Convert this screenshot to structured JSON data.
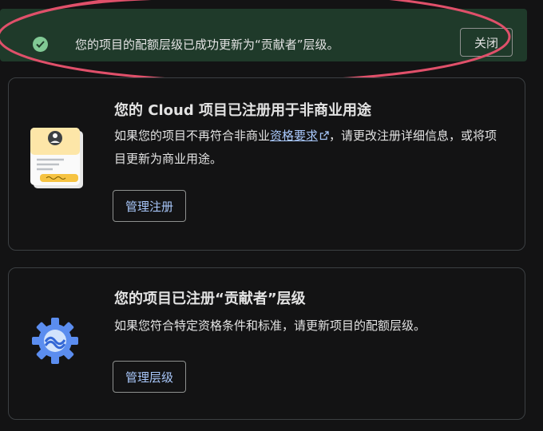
{
  "banner": {
    "message": "您的项目的配额层级已成功更新为“贡献者”层级。",
    "close_label": "关闭"
  },
  "cards": [
    {
      "title": "您的 Cloud 项目已注册用于非商业用途",
      "body_prefix": "如果您的项目不再符合非商业",
      "body_link": "资格要求",
      "body_suffix": "，请更改注册详细信息，或将项目更新为商业用途。",
      "button_label": "管理注册"
    },
    {
      "title": "您的项目已注册“贡献者”层级",
      "body": "如果您符合特定资格条件和标准，请更新项目的配额层级。",
      "button_label": "管理层级"
    }
  ],
  "colors": {
    "background": "#131314",
    "banner_bg": "#1f3a2a",
    "success": "#81c995",
    "link": "#a8c7fa",
    "border": "#3c4043"
  }
}
